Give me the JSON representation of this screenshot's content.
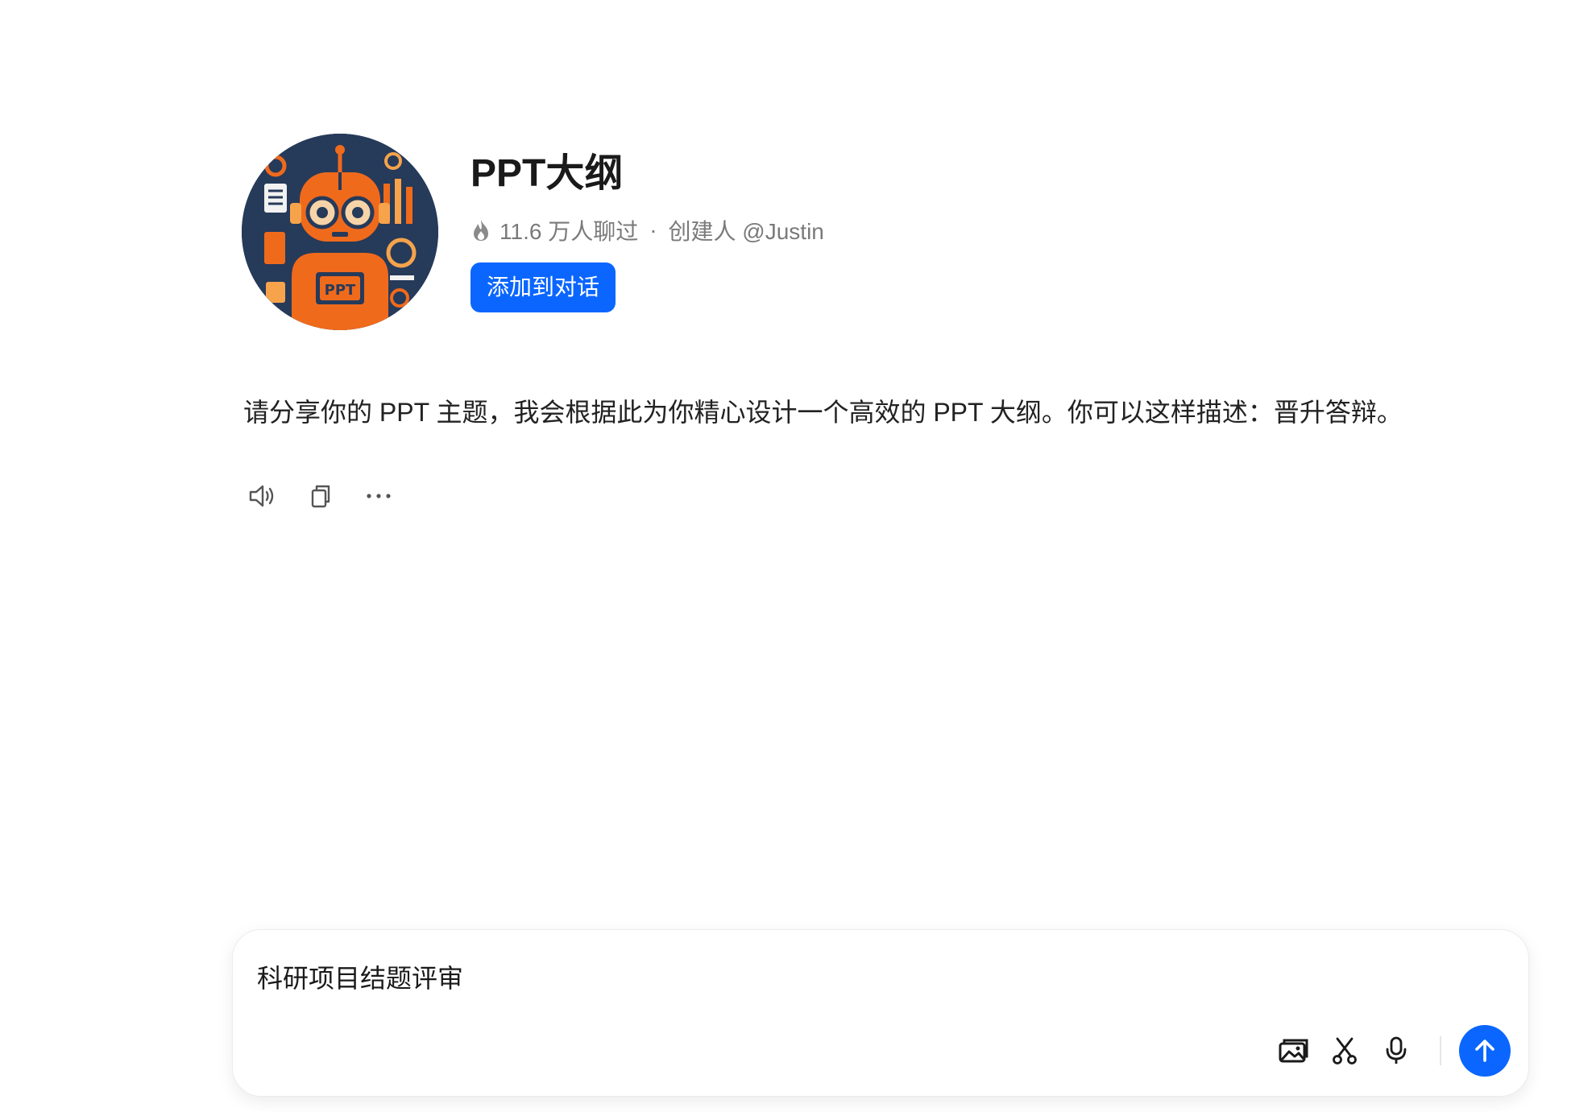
{
  "bot": {
    "title": "PPT大纲",
    "chat_count": "11.6 万人聊过",
    "separator": "·",
    "creator": "创建人 @Justin",
    "add_button_label": "添加到对话",
    "avatar_text": "PPT"
  },
  "intro": {
    "message": "请分享你的 PPT 主题，我会根据此为你精心设计一个高效的 PPT 大纲。你可以这样描述：晋升答辩。"
  },
  "message_actions": [
    {
      "icon": "speaker-icon"
    },
    {
      "icon": "copy-icon"
    },
    {
      "icon": "more-icon"
    }
  ],
  "input": {
    "value": "科研项目结题评审"
  },
  "input_tools": [
    {
      "icon": "image-upload-icon"
    },
    {
      "icon": "scissors-icon"
    },
    {
      "icon": "microphone-icon"
    },
    {
      "icon": "send-arrow-icon"
    }
  ],
  "colors": {
    "accent": "#0a66ff",
    "avatar_bg": "#263a5a",
    "avatar_orange": "#f06a1c"
  }
}
